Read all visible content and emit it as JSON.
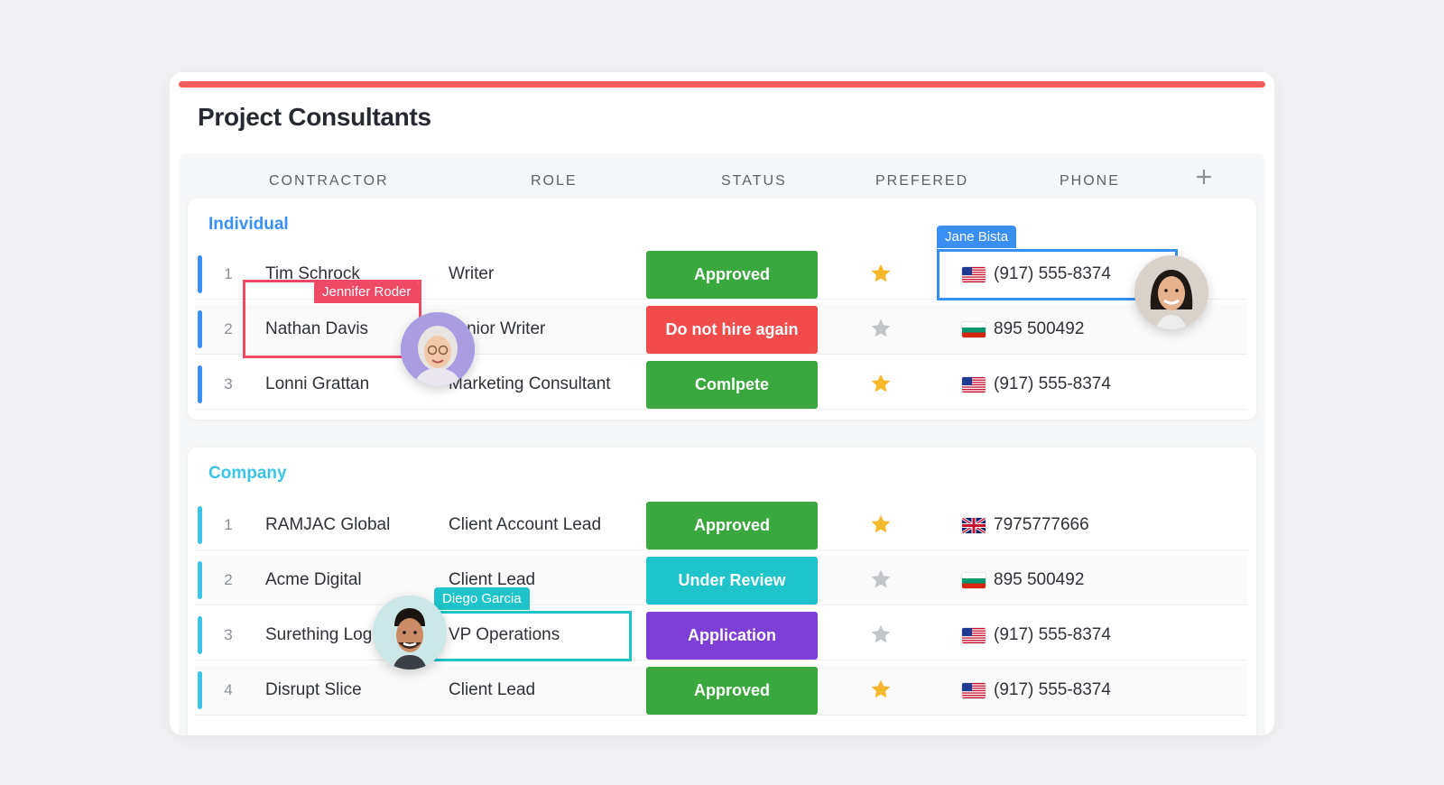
{
  "title": "Project Consultants",
  "colors": {
    "accent_bar": "#f45b5b",
    "individual": "#3a8ff5",
    "company": "#3cc4e6",
    "approved": "#3aa83e",
    "do_not_hire": "#f24b4b",
    "complete": "#3aa83e",
    "under_review": "#1ec4c9",
    "application": "#7e3fd6",
    "star_on": "#f5b82a",
    "star_off": "#c2c5ca"
  },
  "columns": {
    "contractor": "CONTRACTOR",
    "role": "ROLE",
    "status": "STATUS",
    "preferred": "PREFERED",
    "phone": "PHONE",
    "add_icon": "plus-icon"
  },
  "groups": {
    "individual": {
      "label": "Individual",
      "rows": [
        {
          "num": "1",
          "name": "Tim Schrock",
          "role": "Writer",
          "status": "Approved",
          "status_key": "approved",
          "preferred": true,
          "flag": "us",
          "phone": "(917) 555-8374"
        },
        {
          "num": "2",
          "name": "Nathan Davis",
          "role": "Junior Writer",
          "status": "Do not hire again",
          "status_key": "do_not_hire",
          "preferred": false,
          "flag": "bg",
          "phone": "895 500492"
        },
        {
          "num": "3",
          "name": "Lonni Grattan",
          "role": "Marketing Consultant",
          "status": "Comlpete",
          "status_key": "complete",
          "preferred": true,
          "flag": "us",
          "phone": "(917) 555-8374"
        }
      ]
    },
    "company": {
      "label": "Company",
      "rows": [
        {
          "num": "1",
          "name": "RAMJAC Global",
          "role": "Client Account Lead",
          "status": "Approved",
          "status_key": "approved",
          "preferred": true,
          "flag": "gb",
          "phone": "7975777666"
        },
        {
          "num": "2",
          "name": "Acme Digital",
          "role": "Client Lead",
          "status": "Under Review",
          "status_key": "under_review",
          "preferred": false,
          "flag": "bg",
          "phone": "895 500492"
        },
        {
          "num": "3",
          "name": "Surething Logistics",
          "role": "VP Operations",
          "status": "Application",
          "status_key": "application",
          "preferred": false,
          "flag": "us",
          "phone": "(917) 555-8374"
        },
        {
          "num": "4",
          "name": "Disrupt Slice",
          "role": "Client Lead",
          "status": "Approved",
          "status_key": "approved",
          "preferred": true,
          "flag": "us",
          "phone": "(917) 555-8374"
        }
      ]
    }
  },
  "collaborators": {
    "jennifer": {
      "name": "Jennifer Roder",
      "color": "#ee4a66"
    },
    "jane": {
      "name": "Jane Bista",
      "color": "#3a8ff5"
    },
    "diego": {
      "name": "Diego Garcia",
      "color": "#1ec4c9"
    }
  }
}
